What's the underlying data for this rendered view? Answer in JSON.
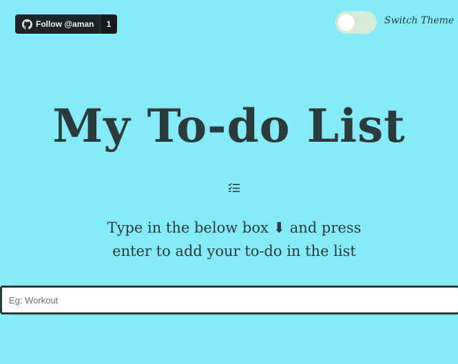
{
  "github": {
    "label": "Follow @aman",
    "count": "1",
    "icon": "github-icon"
  },
  "theme_switch": {
    "label": "Switch Theme",
    "state": "off"
  },
  "title": "My To-do List",
  "list_icon": "checklist-icon",
  "instructions": {
    "line1": "Type in the below box ⬇ and press",
    "line2": "enter to add your to-do in the list"
  },
  "todo_input": {
    "placeholder": "Eg: Workout",
    "value": ""
  },
  "colors": {
    "background": "#85ebf9",
    "text": "#2b3a3a",
    "switch_track": "#d6ecd6"
  }
}
